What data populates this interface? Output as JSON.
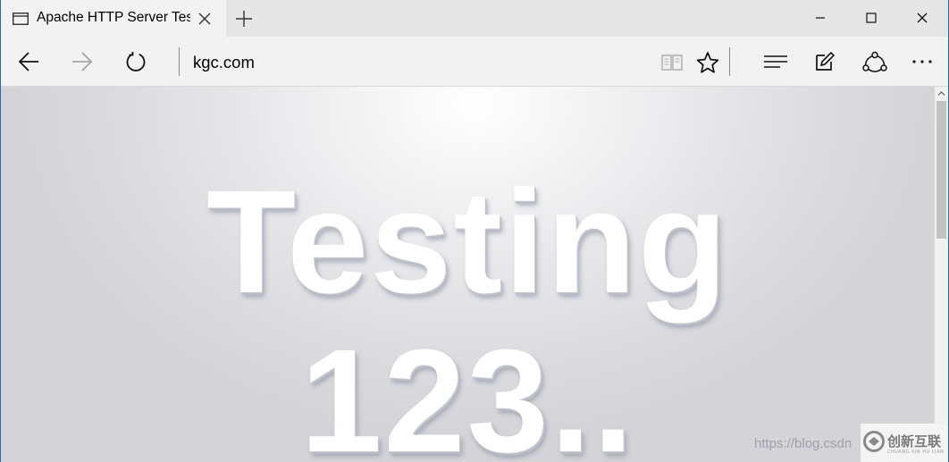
{
  "window": {
    "tab_title": "Apache HTTP Server Tes",
    "icons": {
      "tab": "page-icon",
      "close_tab": "close-icon",
      "new_tab": "plus-icon",
      "minimize": "minimize-icon",
      "maximize": "maximize-icon",
      "close": "close-icon"
    }
  },
  "navbar": {
    "address": "kgc.com",
    "icons": [
      "back-arrow-icon",
      "forward-arrow-icon",
      "refresh-icon",
      "reading-view-icon",
      "favorite-star-icon",
      "hub-icon",
      "web-note-icon",
      "share-icon",
      "more-icon"
    ]
  },
  "page": {
    "headline_line1": "Testing",
    "headline_line2": "123.."
  },
  "watermark": {
    "url": "https://blog.csdn",
    "logo_text": "创新互联",
    "logo_sub": "CHUANG XIN HU LIAN"
  },
  "colors": {
    "window_border": "#1e6fb8",
    "tab_active": "#f2f2f2",
    "tabstrip": "#e6e6e6",
    "navbar": "#f2f2f2",
    "page_background": "#dcdce0",
    "headline_text": "#ffffff"
  }
}
